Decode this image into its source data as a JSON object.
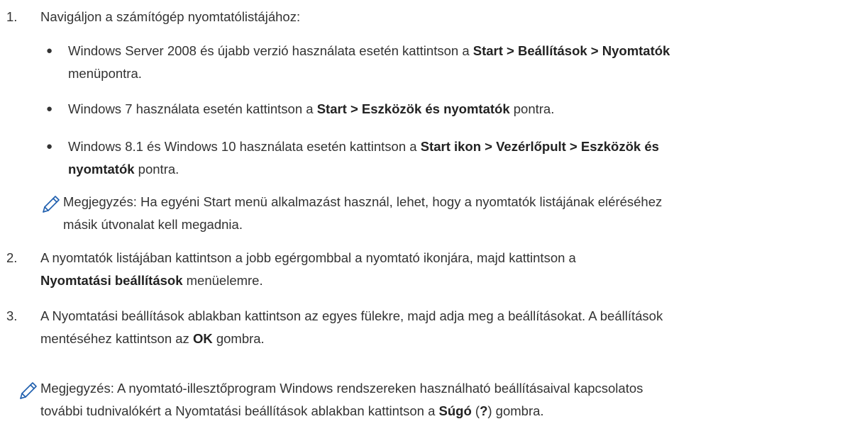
{
  "steps": [
    {
      "number": "1.",
      "text": "Navigáljon a számítógép nyomtatólistájához:",
      "bullets": [
        {
          "t1": "Windows Server 2008 és újabb verzió használata esetén kattintson a ",
          "b1": "Start > Beállítások > Nyomtatók",
          "t2": "menüpontra."
        },
        {
          "t1": "Windows 7 használata esetén kattintson a ",
          "b1": "Start > Eszközök és nyomtatók",
          "t2": " pontra."
        },
        {
          "t1": "Windows 8.1 és Windows 10 használata esetén kattintson a ",
          "b1": "Start ikon > Vezérlőpult > Eszközök és",
          "b2": "nyomtatók",
          "t2": " pontra."
        }
      ],
      "note": {
        "line1": "Megjegyzés: Ha egyéni Start menü alkalmazást használ, lehet, hogy a nyomtatók listájának eléréséhez",
        "line2": "másik útvonalat kell megadnia."
      }
    },
    {
      "number": "2.",
      "line1": "A nyomtatók listájában kattintson a jobb egérgombbal a nyomtató ikonjára, majd kattintson a",
      "bold": "Nyomtatási beállítások",
      "rest": " menüelemre."
    },
    {
      "number": "3.",
      "line1": "A Nyomtatási beállítások ablakban kattintson az egyes fülekre, majd adja meg a beállításokat. A beállítások",
      "t1": "mentéséhez kattintson az ",
      "bold": "OK",
      "rest": " gombra.",
      "note": {
        "line1": "Megjegyzés: A nyomtató-illesztőprogram Windows rendszereken használható beállításaival kapcsolatos",
        "t1": "további tudnivalókért a Nyomtatási beállítások ablakban kattintson a ",
        "b1": "Súgó",
        "t2": " (",
        "b2": "?",
        "t3": ") gombra."
      }
    }
  ],
  "colors": {
    "text": "#333333",
    "note_icon": "#1f5fae"
  },
  "icons": {
    "note": "pencil-note-icon"
  }
}
